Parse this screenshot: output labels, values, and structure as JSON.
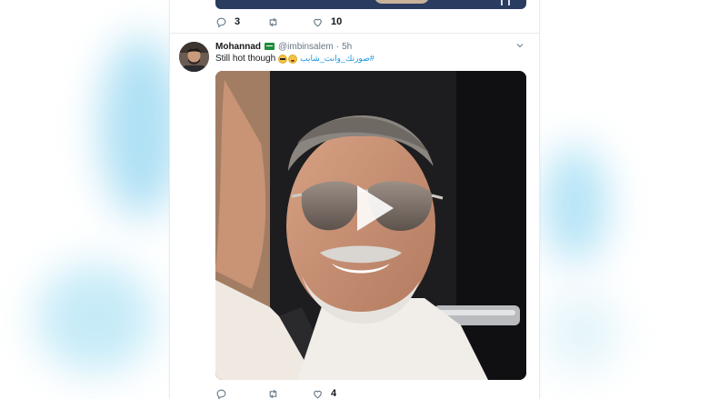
{
  "previous_tweet": {
    "actions": {
      "reply_count": "3",
      "retweet_count": "",
      "like_count": "10"
    }
  },
  "tweet": {
    "user_name": "Mohannad",
    "handle": "@imbinsalem",
    "separator": "·",
    "time": "5h",
    "text": "Still hot though",
    "hashtag": "#صورتك_وانت_شايب",
    "media_type": "video",
    "actions": {
      "reply_count": "",
      "retweet_count": "",
      "like_count": "4"
    }
  },
  "colors": {
    "link": "#1b95e0",
    "muted_text": "#657786",
    "primary_text": "#14171a",
    "divider": "#e6ecf0"
  },
  "icons": [
    "reply-icon",
    "retweet-icon",
    "like-icon",
    "caret-down-icon",
    "play-icon",
    "flag-icon"
  ]
}
